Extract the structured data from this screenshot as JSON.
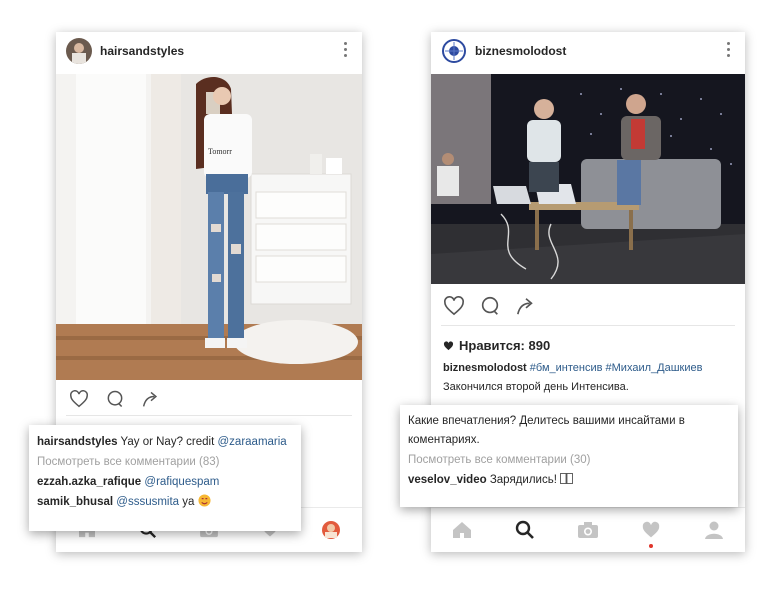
{
  "left_post": {
    "username": "hairsandstyles",
    "caption": {
      "user": "hairsandstyles",
      "text": "Yay or Nay? credit",
      "mention": "@zaraamaria"
    },
    "view_all": "Посмотреть все комментарии (83)",
    "comments": [
      {
        "user": "ezzah.azka_rafique",
        "mention": "@rafiquespam",
        "text": ""
      },
      {
        "user": "samik_bhusal",
        "mention": "@sssusmita",
        "text": "ya"
      }
    ]
  },
  "right_post": {
    "username": "biznesmolodost",
    "likes": "Нравится: 890",
    "caption": {
      "user": "biznesmolodost",
      "tags": "#бм_интенсив #Михаил_Дашкиев",
      "line2": "Закончился второй день Интенсива."
    },
    "popup_text": "Какие впечатления? Делитесь вашими инсайтами в коментариях.",
    "view_all": "Посмотреть все комментарии (30)",
    "comment": {
      "user": "veselov_video",
      "text": "Зарядились!"
    }
  },
  "icons": {
    "like": "heart-icon",
    "comment": "comment-icon",
    "share": "share-icon",
    "nav": [
      "home-icon",
      "search-icon",
      "camera-icon",
      "heart-icon",
      "profile-icon"
    ]
  },
  "colors": {
    "link": "#2d5b8a",
    "muted": "#a0a0a0",
    "notification": "#e0352b"
  }
}
